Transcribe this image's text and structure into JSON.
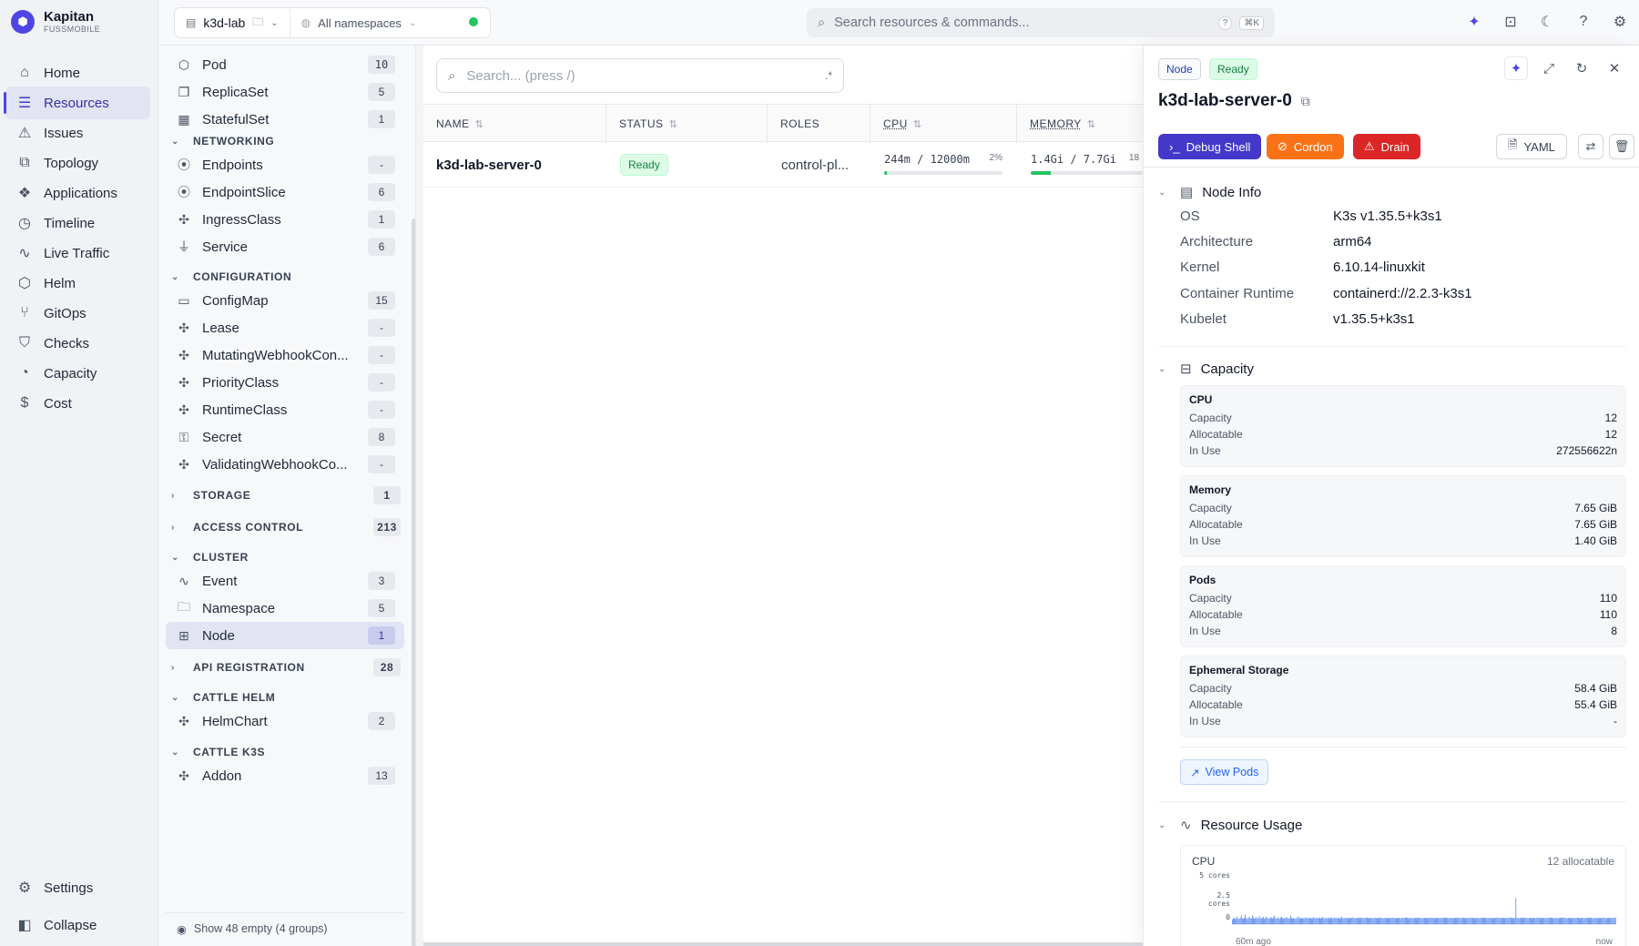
{
  "app": {
    "name": "Kapitan",
    "sub": "FUSSMOBILE"
  },
  "nav": {
    "items": [
      {
        "label": "Home",
        "icon": "home-icon"
      },
      {
        "label": "Resources",
        "icon": "list-icon"
      },
      {
        "label": "Issues",
        "icon": "warning-icon"
      },
      {
        "label": "Topology",
        "icon": "topology-icon"
      },
      {
        "label": "Applications",
        "icon": "applications-icon"
      },
      {
        "label": "Timeline",
        "icon": "clock-icon"
      },
      {
        "label": "Live Traffic",
        "icon": "activity-icon"
      },
      {
        "label": "Helm",
        "icon": "helm-icon"
      },
      {
        "label": "GitOps",
        "icon": "git-icon"
      },
      {
        "label": "Checks",
        "icon": "shield-icon"
      },
      {
        "label": "Capacity",
        "icon": "gauge-icon"
      },
      {
        "label": "Cost",
        "icon": "dollar-icon"
      }
    ],
    "settings": "Settings",
    "collapse": "Collapse"
  },
  "topbar": {
    "context": "k3d-lab",
    "namespace": "All namespaces",
    "search_placeholder": "Search resources & commands...",
    "shortcut": "⌘K"
  },
  "sidebar": {
    "rows": [
      {
        "label": "Pod",
        "count": "10"
      },
      {
        "label": "ReplicaSet",
        "count": "5"
      },
      {
        "label": "StatefulSet",
        "count": "1"
      },
      {
        "label": "Endpoints",
        "count": "-"
      },
      {
        "label": "EndpointSlice",
        "count": "6"
      },
      {
        "label": "IngressClass",
        "count": "1"
      },
      {
        "label": "Service",
        "count": "6"
      },
      {
        "label": "ConfigMap",
        "count": "15"
      },
      {
        "label": "Lease",
        "count": "-"
      },
      {
        "label": "MutatingWebhookCon...",
        "count": "-"
      },
      {
        "label": "PriorityClass",
        "count": "-"
      },
      {
        "label": "RuntimeClass",
        "count": "-"
      },
      {
        "label": "Secret",
        "count": "8"
      },
      {
        "label": "ValidatingWebhookCo...",
        "count": "-"
      },
      {
        "label": "Event",
        "count": "3"
      },
      {
        "label": "Namespace",
        "count": "5"
      },
      {
        "label": "Node",
        "count": "1"
      },
      {
        "label": "HelmChart",
        "count": "2"
      },
      {
        "label": "Addon",
        "count": "13"
      }
    ],
    "groups": [
      {
        "label": "NETWORKING",
        "count": ""
      },
      {
        "label": "CONFIGURATION",
        "count": ""
      },
      {
        "label": "STORAGE",
        "count": "1"
      },
      {
        "label": "ACCESS CONTROL",
        "count": "213"
      },
      {
        "label": "CLUSTER",
        "count": ""
      },
      {
        "label": "API REGISTRATION",
        "count": "28"
      },
      {
        "label": "CATTLE HELM",
        "count": ""
      },
      {
        "label": "CATTLE K3S",
        "count": ""
      }
    ],
    "footer": "Show 48 empty (4 groups)"
  },
  "list": {
    "search_placeholder": "Search... (press /)",
    "regex_label": ".*",
    "columns": [
      "NAME",
      "STATUS",
      "ROLES",
      "CPU",
      "MEMORY"
    ],
    "rows": [
      {
        "name": "k3d-lab-server-0",
        "status": "Ready",
        "roles": "control-pl...",
        "cpu": "244m / 12000m",
        "cpu_pct": "2%",
        "cpu_fraction": 0.02,
        "memory": "1.4Gi / 7.7Gi",
        "memory_pct": "18",
        "memory_fraction": 0.18
      }
    ]
  },
  "detail": {
    "kind": "Node",
    "status": "Ready",
    "title": "k3d-lab-server-0",
    "actions": {
      "debug": "Debug Shell",
      "cordon": "Cordon",
      "drain": "Drain",
      "yaml": "YAML"
    },
    "node_info": {
      "heading": "Node Info",
      "rows": [
        {
          "k": "OS",
          "v": "K3s v1.35.5+k3s1"
        },
        {
          "k": "Architecture",
          "v": "arm64"
        },
        {
          "k": "Kernel",
          "v": "6.10.14-linuxkit"
        },
        {
          "k": "Container Runtime",
          "v": "containerd://2.2.3-k3s1"
        },
        {
          "k": "Kubelet",
          "v": "v1.35.5+k3s1"
        }
      ]
    },
    "capacity": {
      "heading": "Capacity",
      "cards": [
        {
          "title": "CPU",
          "rows": [
            {
              "k": "Capacity",
              "v": "12"
            },
            {
              "k": "Allocatable",
              "v": "12"
            },
            {
              "k": "In Use",
              "v": "272556622n"
            }
          ]
        },
        {
          "title": "Memory",
          "rows": [
            {
              "k": "Capacity",
              "v": "7.65 GiB"
            },
            {
              "k": "Allocatable",
              "v": "7.65 GiB"
            },
            {
              "k": "In Use",
              "v": "1.40 GiB"
            }
          ]
        },
        {
          "title": "Pods",
          "rows": [
            {
              "k": "Capacity",
              "v": "110"
            },
            {
              "k": "Allocatable",
              "v": "110"
            },
            {
              "k": "In Use",
              "v": "8"
            }
          ]
        },
        {
          "title": "Ephemeral Storage",
          "rows": [
            {
              "k": "Capacity",
              "v": "58.4 GiB"
            },
            {
              "k": "Allocatable",
              "v": "55.4 GiB"
            },
            {
              "k": "In Use",
              "v": "-"
            }
          ]
        }
      ],
      "view_pods": "View Pods"
    },
    "usage": {
      "heading": "Resource Usage",
      "cpu_label": "CPU",
      "allocatable": "12 allocatable",
      "ticks": [
        "5 cores",
        "2.5 cores",
        "0"
      ],
      "x_start": "60m ago",
      "x_end": "now"
    }
  },
  "chart_data": {
    "type": "bar",
    "title": "CPU",
    "xlabel": "",
    "ylabel": "",
    "ylim": [
      0,
      5
    ],
    "x": [
      "60m ago",
      "now"
    ],
    "values": [
      0.22,
      0.25,
      0.3,
      0.24,
      0.28,
      0.35,
      0.24,
      0.26,
      0.3,
      0.42,
      0.27,
      0.25,
      0.3,
      0.45,
      0.28,
      0.24,
      0.3,
      0.35,
      0.26,
      0.27,
      0.4,
      0.3,
      0.25,
      0.28,
      0.32,
      0.26,
      0.29,
      0.38,
      0.25,
      0.27,
      0.3,
      0.34,
      0.26,
      0.28,
      0.36,
      0.3,
      0.25,
      0.27,
      0.33,
      0.29,
      0.26,
      0.3,
      0.4,
      0.27,
      0.26,
      0.31,
      0.28,
      0.25,
      0.3,
      0.35,
      0.28,
      0.26,
      0.29,
      0.27,
      0.33,
      0.3,
      0.26,
      0.28,
      0.41,
      0.29,
      0.26,
      0.3,
      0.27,
      0.25,
      0.31,
      0.28,
      0.36,
      0.26,
      0.3,
      0.27,
      0.29,
      0.26,
      0.3,
      0.28,
      0.32,
      0.26,
      0.29,
      0.27,
      0.3,
      0.26,
      0.28,
      0.34,
      0.27,
      0.29,
      0.3,
      0.26,
      0.31,
      0.28,
      0.27,
      0.3,
      0.33,
      0.28,
      0.26,
      0.3,
      0.29,
      0.27,
      0.3,
      0.26,
      0.32,
      0.28,
      0.27,
      0.29,
      0.31,
      0.27,
      0.3,
      0.28,
      0.29,
      0.26,
      0.3,
      0.35,
      0.27,
      0.29,
      0.28,
      0.3,
      0.26,
      0.31,
      0.28,
      0.27,
      0.3,
      0.29,
      0.32,
      0.28,
      0.27,
      0.29,
      0.3,
      0.27,
      0.28,
      0.31,
      0.29,
      0.3,
      0.27,
      0.28,
      0.3,
      0.29,
      0.31,
      0.28,
      0.27,
      0.29,
      0.3,
      0.28,
      0.27,
      0.29,
      0.3,
      0.28,
      0.29,
      0.27,
      0.31,
      0.29,
      0.3,
      0.28,
      0.27,
      0.29,
      0.3,
      0.28,
      0.29,
      0.27,
      0.3,
      0.29,
      0.28,
      0.31,
      0.29,
      0.3,
      0.28,
      0.27,
      0.29,
      0.3,
      0.28,
      0.29,
      0.27,
      0.3,
      0.29,
      0.28,
      0.31,
      0.29,
      0.3,
      0.28,
      0.27,
      0.29,
      0.3,
      0.28,
      0.29,
      0.27,
      0.3,
      0.29,
      0.28,
      0.31,
      0.29,
      0.3,
      0.28,
      0.27,
      0.29,
      0.3,
      0.28,
      0.29,
      0.27,
      0.3,
      0.29,
      0.28,
      0.31,
      0.29,
      0.3,
      0.28,
      0.27,
      0.29,
      0.3,
      0.28,
      0.29,
      0.27,
      0.3,
      0.29,
      0.28,
      0.31,
      0.29,
      0.3,
      0.28,
      0.27,
      0.29,
      0.3,
      0.28,
      0.29,
      0.27,
      0.3,
      0.29,
      0.28,
      0.31,
      0.29,
      0.3,
      0.28,
      0.27,
      0.29,
      0.3,
      0.28,
      0.29,
      0.27,
      0.3,
      0.29,
      0.28,
      0.31,
      0.29,
      0.3,
      0.28,
      0.27,
      0.29,
      0.3,
      0.28,
      0.29,
      0.27,
      0.3,
      0.29,
      0.28,
      0.31,
      0.29,
      0.3,
      0.28,
      0.27,
      0.29,
      0.3,
      0.28,
      0.29,
      0.27,
      0.3,
      0.29,
      0.28,
      0.31,
      0.29,
      0.3,
      0.28,
      0.27,
      0.29,
      0.3,
      0.28,
      0.29,
      0.27,
      0.3,
      0.29,
      0.28,
      0.31,
      0.29,
      0.3,
      0.28,
      0.27,
      0.29,
      1.2,
      0.3,
      0.28,
      0.29,
      0.27,
      0.3,
      0.29,
      0.28,
      0.31,
      0.29,
      0.3,
      0.28,
      0.27,
      0.29,
      0.3,
      0.28,
      0.29,
      0.27,
      0.3,
      0.29,
      0.28,
      0.31,
      0.29,
      0.3,
      0.28,
      0.27,
      0.29,
      0.3,
      0.28,
      0.29,
      0.27,
      0.3,
      0.29,
      0.28,
      0.31,
      0.29,
      0.3,
      0.28,
      0.27,
      0.29,
      0.3,
      0.28,
      0.29,
      0.27,
      0.3,
      0.29,
      0.28,
      0.31,
      0.29,
      0.3,
      0.28,
      0.27,
      0.29,
      0.3,
      0.28,
      0.29,
      0.27,
      0.3,
      0.29,
      0.28,
      0.31,
      0.29,
      0.3,
      0.28,
      0.27,
      0.29,
      0.3,
      0.28,
      0.29,
      0.27,
      0.3,
      0.29,
      0.28,
      0.31,
      0.29,
      0.3,
      0.28,
      0.27,
      0.29,
      0.3,
      0.28,
      0.29,
      0.27,
      0.3,
      0.29,
      0.28,
      0.31,
      0.29,
      0.3,
      0.28,
      0.27,
      0.29,
      0.3,
      0.28,
      0.29,
      0.27,
      0.3,
      0.29,
      0.28,
      0.31
    ]
  },
  "colors": {
    "accent": "#4f46e5",
    "ready": "#22c55e",
    "cordon": "#f97316",
    "drain": "#dc2626",
    "chart": "#2563eb"
  }
}
